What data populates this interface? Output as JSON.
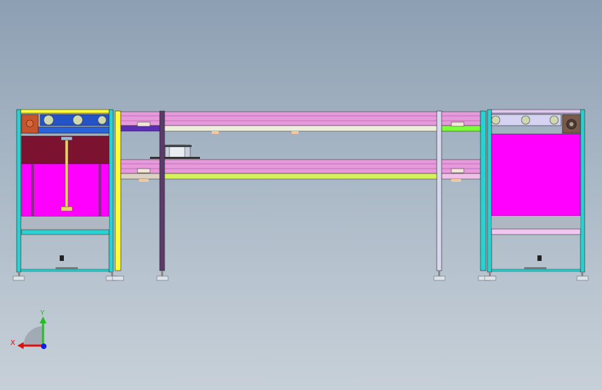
{
  "window": {
    "background_top": "#8d9fb3",
    "background_bottom": "#c7d0d8"
  },
  "model": {
    "view": "front",
    "frame_color": "#2ad1d1",
    "rail_color": "#e69adb",
    "panel_color": "#ff00ff",
    "accent_yellow": "#ffff33",
    "accent_green": "#7cff3a",
    "motor_color": "#c8542b",
    "belt_color": "#2453c8",
    "hopper_color": "#7a1230"
  },
  "triad": {
    "x_label": "X",
    "y_label": "Y",
    "x_color": "#e01010",
    "y_color": "#20c020",
    "z_color": "#1020e0"
  }
}
